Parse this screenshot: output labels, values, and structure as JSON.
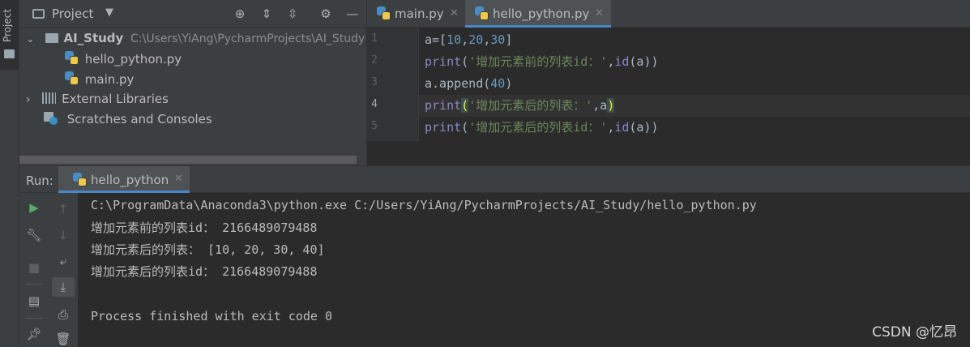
{
  "stripe": {
    "label": "Project"
  },
  "project": {
    "title": "Project",
    "tree": [
      {
        "name": "AI_Study",
        "path": "C:\\Users\\YiAng\\PycharmProjects\\AI_Study"
      },
      {
        "name": "hello_python.py"
      },
      {
        "name": "main.py"
      },
      {
        "name": "External Libraries"
      },
      {
        "name": "Scratches and Consoles"
      }
    ]
  },
  "editor": {
    "tabs": [
      {
        "label": "main.py"
      },
      {
        "label": "hello_python.py"
      }
    ],
    "line_numbers": [
      "1",
      "2",
      "3",
      "4",
      "5"
    ],
    "current_line": "4"
  },
  "code": [
    {
      "t1": "a",
      "t2": "=[",
      "n1": "10",
      "c1": ",",
      "n2": "20",
      "c2": ",",
      "n3": "30",
      "t3": "]"
    },
    {
      "kw": "print",
      "p1": "(",
      "str": "'增加元素前的列表id：'",
      "c1": ",",
      "kw2": "id",
      "rest": "(a))"
    },
    {
      "t1": "a.append(",
      "num": "40",
      "t2": ")"
    },
    {
      "kw": "print",
      "p1": "(",
      "str": "'增加元素后的列表：'",
      "c1": ",",
      "var": "a",
      "p2": ")"
    },
    {
      "kw": "print",
      "p1": "(",
      "str": "'增加元素后的列表id：'",
      "c1": ",",
      "kw2": "id",
      "rest": "(a))"
    }
  ],
  "run": {
    "label": "Run:",
    "tab": "hello_python",
    "output": [
      "C:\\ProgramData\\Anaconda3\\python.exe C:/Users/YiAng/PycharmProjects/AI_Study/hello_python.py",
      "增加元素前的列表id： 2166489079488",
      "增加元素后的列表： [10, 20, 30, 40]",
      "增加元素后的列表id： 2166489079488",
      "",
      "Process finished with exit code 0"
    ]
  },
  "watermark": "CSDN @忆昂",
  "colors": {
    "background": "#2b2b2b",
    "panel": "#3c3f41",
    "keyword": "#8888c6",
    "number": "#6897bb",
    "string": "#6a8759",
    "run_green": "#59a869",
    "accent": "#4a88c7"
  }
}
